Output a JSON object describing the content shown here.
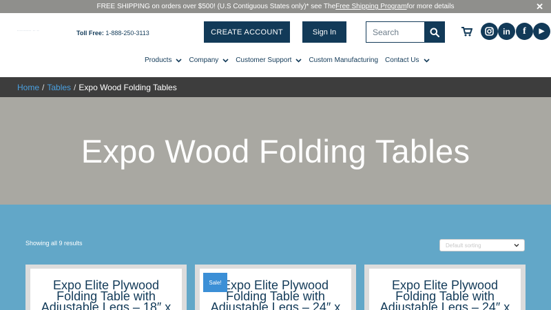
{
  "banner": {
    "text_before": "FREE SHIPPING on orders over $500! (U.S Contiguous States only)* see The ",
    "link": "Free Shipping Program",
    "text_after": " for more details",
    "close": "✕"
  },
  "header": {
    "logo_text": "...........  .. ..",
    "tollfree_label": "Toll Free:",
    "tollfree_number": "1-888-250-3113",
    "create_account": "CREATE ACCOUNT",
    "sign_in": "Sign In",
    "search_placeholder": "Search",
    "social": {
      "instagram": "◎",
      "linkedin": "in",
      "facebook": "f",
      "youtube": "▶"
    }
  },
  "nav": {
    "items": [
      {
        "label": "Products"
      },
      {
        "label": "Company"
      },
      {
        "label": "Customer Support"
      },
      {
        "label": "Custom Manufacturing"
      },
      {
        "label": "Contact Us"
      }
    ]
  },
  "breadcrumb": {
    "home": "Home",
    "sep": "/",
    "tables": "Tables",
    "current": "Expo Wood Folding Tables"
  },
  "hero": {
    "title": "Expo Wood Folding Tables"
  },
  "shop": {
    "result_count": "Showing all 9 results",
    "sort_value": "Default sorting",
    "sale_badge": "Sale!",
    "cards": [
      {
        "line1": "Expo Elite Plywood",
        "line2": "Folding Table with",
        "line3": "Adjustable Legs – 18″ x"
      },
      {
        "line1": "Expo Elite Plywood",
        "line2": "Folding Table with",
        "line3": "Adjustable Legs – 24″ x"
      },
      {
        "line1": "Expo Elite Plywood",
        "line2": "Folding Table with",
        "line3": "Adjustable Legs – 24″ x"
      }
    ]
  },
  "colors": {
    "navy": "#123a58",
    "banner_gray": "#8f8f8c",
    "hero_gray": "#a9a8a2",
    "shop_blue": "#62a7c8",
    "link_blue": "#4aa0e0",
    "sale_blue": "#3b8fd6"
  }
}
